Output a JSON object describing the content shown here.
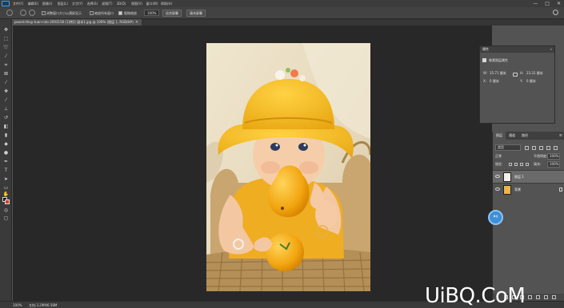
{
  "app": {
    "name": "Photoshop",
    "accent_color": "#31a8ff"
  },
  "menubar": {
    "items": [
      "文件(F)",
      "编辑(E)",
      "图像(I)",
      "图层(L)",
      "文字(Y)",
      "选择(S)",
      "滤镜(T)",
      "3D(D)",
      "视图(V)",
      "窗口(W)",
      "帮助(H)"
    ],
    "window_controls": [
      "—",
      "□",
      "✕"
    ]
  },
  "options_bar": {
    "resize_windows_label": "调整窗口大小以满屏显示",
    "zoom_all_windows_label": "缩放所有窗口",
    "scrubby_zoom_label": "细微缩放",
    "scrubby_zoom_checked": true,
    "zoom_value": "100%",
    "fit_screen_button": "适合屏幕",
    "fill_screen_button": "填充屏幕"
  },
  "document_tab": {
    "label": "pexels-thuy-tuan-ndo-2093158 (1)拷贝 副本1.jpg @ 100% (图层 1, RGB/8#)",
    "close_icon": "×"
  },
  "properties_panel": {
    "title": "属性",
    "collapse_icon": "«",
    "subtitle": "像素图层属性",
    "fields": [
      {
        "label": "W:",
        "value": "15.71 厘米"
      },
      {
        "label": "H:",
        "value": "23.31 厘米"
      },
      {
        "label": "X:",
        "value": "0 厘米"
      },
      {
        "label": "Y:",
        "value": "0 厘米"
      }
    ]
  },
  "layers_panel": {
    "tabs": [
      "图层",
      "通道",
      "路径"
    ],
    "menu_icon": "≡",
    "kind_filter": "类型",
    "blend_mode": "正常",
    "opacity_label": "不透明度:",
    "opacity_value": "100%",
    "lock_label": "锁定:",
    "fill_label": "填充:",
    "fill_value": "100%",
    "layers": [
      {
        "name": "图层 1",
        "selected": true,
        "visible": true
      },
      {
        "name": "背景",
        "selected": false,
        "visible": true,
        "locked": true
      }
    ]
  },
  "cursor_overlay": {
    "label": "单击",
    "color": "#3d8fd9"
  },
  "status_bar": {
    "zoom": "100%",
    "doc_info": "文档:3.29M/6.58M"
  },
  "watermark": {
    "text": "UiBQ.CoM"
  }
}
